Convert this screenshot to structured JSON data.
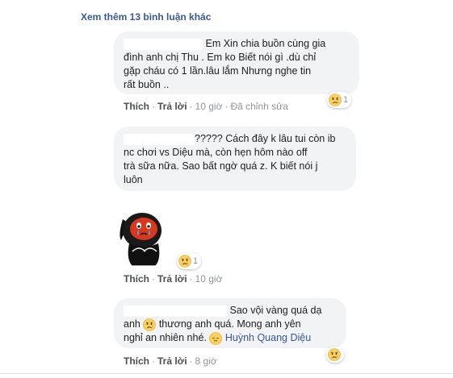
{
  "more_comments": "Xem thêm 13 bình luận khác",
  "comments": [
    {
      "lines": [
        "Em Xin chia buồn cùng gia",
        "đình anh chị Thu . Em ko Biết nói gì .dù chỉ",
        "gặp cháu có 1 lần.lâu lắm Nhưng nghe tin",
        "rất buồn .."
      ],
      "like": "Thích",
      "reply": "Trả lời",
      "time": "10 giờ",
      "edited": "Đã chỉnh sửa",
      "reaction": {
        "icon": "sad-emoji-icon",
        "count": "1"
      }
    },
    {
      "lines": [
        "????? Cách đây k lâu tui còn ib",
        "nc chơi vs Diệu mà, còn hẹn hôm nào off",
        "trà sữa nữa. Sao bất ngờ quá z. K biết nói j",
        "luôn"
      ],
      "sticker": "crying-cartoon-sticker",
      "like": "Thích",
      "reply": "Trả lời",
      "time": "10 giờ",
      "reaction": {
        "icon": "sad-emoji-icon",
        "count": "1"
      }
    },
    {
      "line1": "Sao vội vàng quá dạ",
      "line2a": "anh",
      "line2b": "thương anh quá. Mong anh yên",
      "line3a": "nghỉ an nhiên nhé.",
      "mention": "Huỳnh Quang Diệu",
      "like": "Thích",
      "reply": "Trả lời",
      "time": "8 giờ",
      "reaction": {
        "icon": "sad-emoji-icon",
        "count": ""
      }
    }
  ],
  "colors": {
    "link": "#385898",
    "bubble": "#f2f3f5",
    "meta": "#90949c"
  }
}
